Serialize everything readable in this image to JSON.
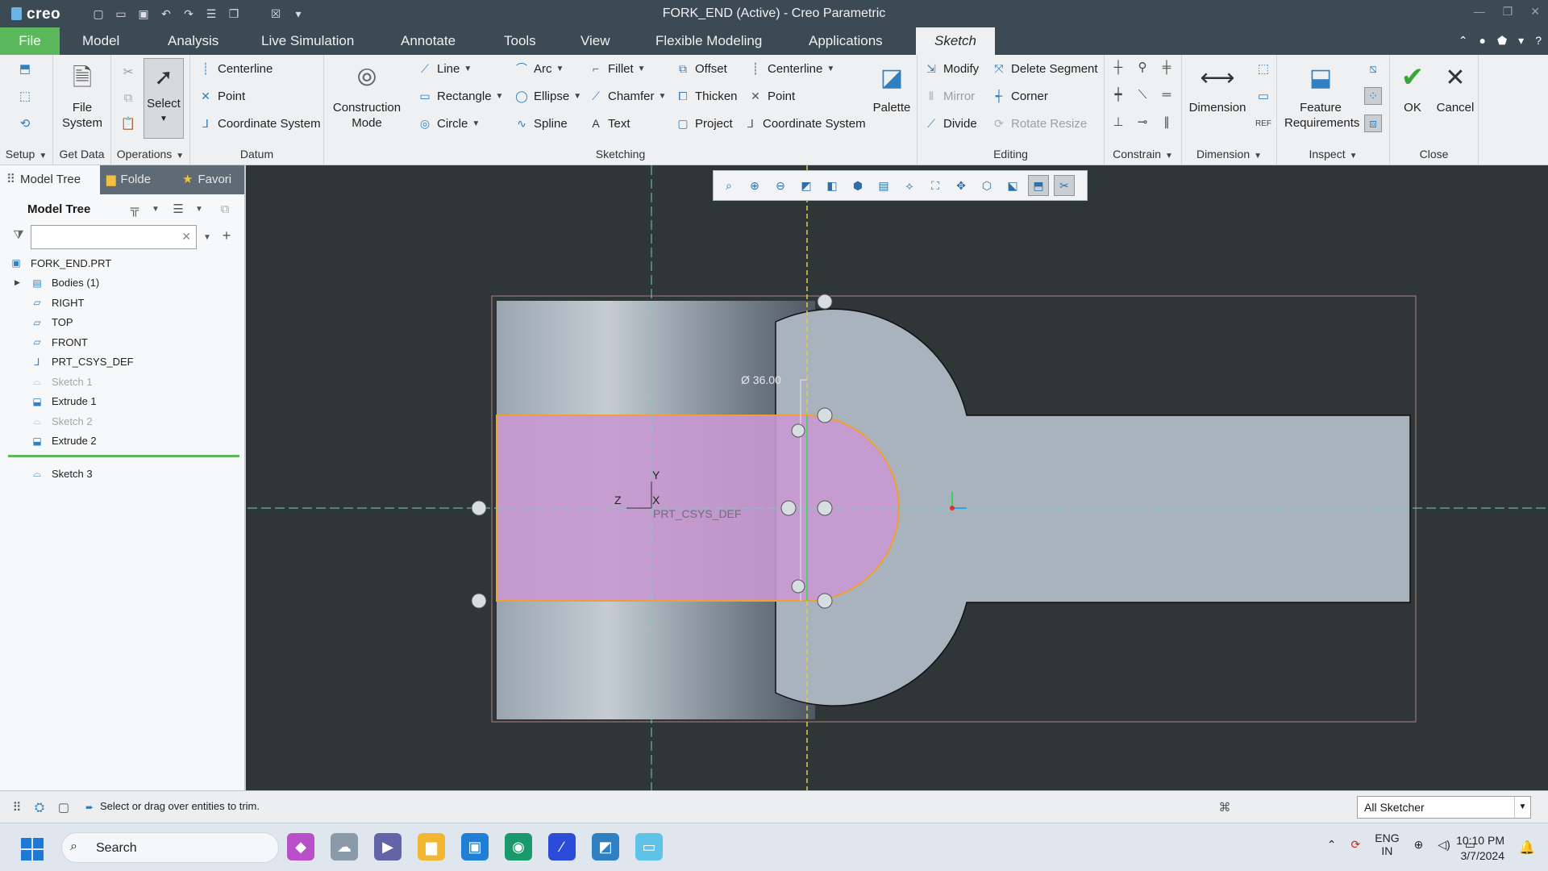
{
  "window": {
    "title": "FORK_END (Active) - Creo Parametric",
    "logo": "creo"
  },
  "tabs": [
    "File",
    "Model",
    "Analysis",
    "Live Simulation",
    "Annotate",
    "Tools",
    "View",
    "Flexible Modeling",
    "Applications",
    "Sketch"
  ],
  "ribbon": {
    "groups": {
      "setup": "Setup",
      "get_data": "Get Data",
      "operations": "Operations",
      "datum": "Datum",
      "sketching": "Sketching",
      "editing": "Editing",
      "constrain": "Constrain",
      "dimension": "Dimension",
      "inspect": "Inspect",
      "close": "Close"
    },
    "file_system": "File System",
    "select": "Select",
    "datum": {
      "centerline": "Centerline",
      "point": "Point",
      "coordinate_system": "Coordinate System"
    },
    "construction_mode": "Construction Mode",
    "sketching": {
      "line": "Line",
      "rectangle": "Rectangle",
      "circle": "Circle",
      "arc": "Arc",
      "ellipse": "Ellipse",
      "spline": "Spline",
      "fillet": "Fillet",
      "chamfer": "Chamfer",
      "text": "Text",
      "offset": "Offset",
      "thicken": "Thicken",
      "project": "Project",
      "centerline": "Centerline",
      "point": "Point",
      "coordinate_system": "Coordinate System",
      "palette": "Palette"
    },
    "editing": {
      "modify": "Modify",
      "mirror": "Mirror",
      "divide": "Divide",
      "delete_segment": "Delete Segment",
      "corner": "Corner",
      "rotate_resize": "Rotate Resize"
    },
    "dimension": "Dimension",
    "feature_requirements": "Feature Requirements",
    "ok": "OK",
    "cancel": "Cancel"
  },
  "left_panel": {
    "tabs": [
      "Model Tree",
      "Folde",
      "Favori"
    ],
    "heading": "Model Tree",
    "search_placeholder": "",
    "items": [
      {
        "label": "FORK_END.PRT",
        "icon": "part-icon",
        "dim": false
      },
      {
        "label": "Bodies (1)",
        "icon": "bodies-icon",
        "dim": false
      },
      {
        "label": "RIGHT",
        "icon": "datum-plane-icon",
        "dim": false
      },
      {
        "label": "TOP",
        "icon": "datum-plane-icon",
        "dim": false
      },
      {
        "label": "FRONT",
        "icon": "datum-plane-icon",
        "dim": false
      },
      {
        "label": "PRT_CSYS_DEF",
        "icon": "csys-icon",
        "dim": false
      },
      {
        "label": "Sketch 1",
        "icon": "sketch-icon",
        "dim": true
      },
      {
        "label": "Extrude 1",
        "icon": "extrude-icon",
        "dim": false
      },
      {
        "label": "Sketch 2",
        "icon": "sketch-icon",
        "dim": true
      },
      {
        "label": "Extrude 2",
        "icon": "extrude-icon",
        "dim": false
      }
    ],
    "active_item": "Sketch 3"
  },
  "graphics": {
    "dimension_label": "Ø 36.00",
    "csys_label": "PRT_CSYS_DEF",
    "axis_y": "Y",
    "axis_x": "X",
    "axis_z": "Z"
  },
  "status": {
    "message": "Select or drag over entities to trim.",
    "filter": "All Sketcher"
  },
  "taskbar": {
    "search": "Search",
    "language": "ENG",
    "region": "IN",
    "time": "10:10 PM",
    "date": "3/7/2024"
  },
  "colors": {
    "title_bg": "#3c4a54",
    "file_tab": "#5cb85c",
    "graphics_bg": "#2f3638",
    "part_face": "#a7b1bb",
    "sketch_fill": "#c898d2",
    "sketch_edge": "#f0a030",
    "datum_line": "#6fd0c0",
    "ref_line": "#e8c84a"
  }
}
